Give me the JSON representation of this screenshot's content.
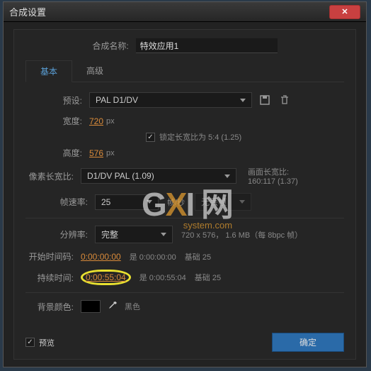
{
  "window": {
    "title": "合成设置"
  },
  "comp": {
    "name_label": "合成名称:",
    "name_value": "特效应用1"
  },
  "tabs": {
    "basic": "基本",
    "advanced": "高级"
  },
  "preset": {
    "label": "预设:",
    "value": "PAL D1/DV"
  },
  "width": {
    "label": "宽度:",
    "value": "720",
    "unit": "px"
  },
  "height": {
    "label": "高度:",
    "value": "576",
    "unit": "px"
  },
  "lock_aspect": {
    "checked": "✓",
    "label": "锁定长宽比为 5:4 (1.25)"
  },
  "par": {
    "label": "像素长宽比:",
    "value": "D1/DV PAL (1.09)",
    "side_label": "画面长宽比:",
    "side_value": "160:117 (1.37)"
  },
  "fps": {
    "label": "帧速率:",
    "value": "25",
    "unit": "帧/秒",
    "drop": "无丢帧"
  },
  "res": {
    "label": "分辨率:",
    "value": "完整",
    "info": "720 x 576， 1.6 MB（每 8bpc 帧）"
  },
  "start": {
    "label": "开始时间码:",
    "value": "0:00:00:00",
    "info_a": "是 0:00:00:00",
    "info_b": "基础 25"
  },
  "duration": {
    "label": "持续时间:",
    "value": "0:00:55:04",
    "info_a": "是 0:00:55:04",
    "info_b": "基础 25"
  },
  "bg": {
    "label": "背景颜色:",
    "name": "黑色"
  },
  "preview": {
    "checked": "✓",
    "label": "预览"
  },
  "ok": "确定",
  "watermark": {
    "brand_prefix": "G",
    "brand_x": "X",
    "brand_suffix": "I 网",
    "sub": "system.com"
  }
}
